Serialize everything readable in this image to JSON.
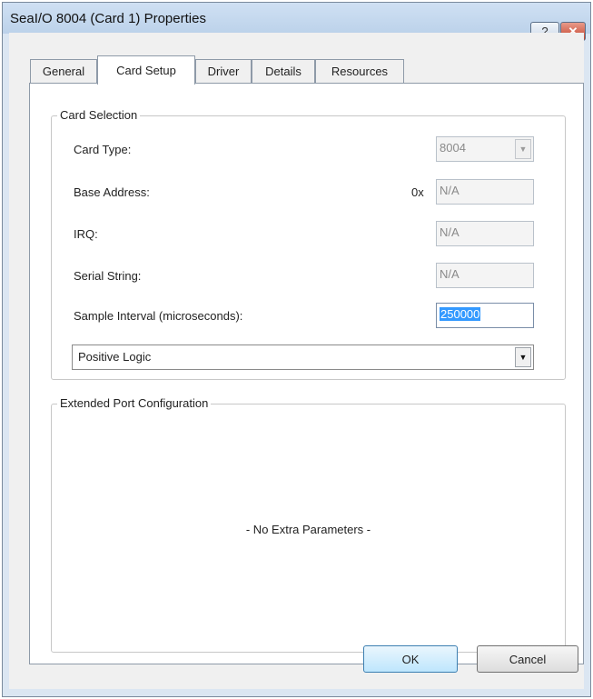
{
  "window": {
    "title": "SeaI/O 8004 (Card 1) Properties"
  },
  "titlebar": {
    "help_label": "?",
    "close_label": "✕"
  },
  "tabs": [
    {
      "label": "General"
    },
    {
      "label": "Card Setup"
    },
    {
      "label": "Driver"
    },
    {
      "label": "Details"
    },
    {
      "label": "Resources"
    }
  ],
  "card_selection": {
    "title": "Card Selection",
    "card_type": {
      "label": "Card Type:",
      "value": "8004"
    },
    "base_address": {
      "label": "Base Address:",
      "prefix": "0x",
      "value": "N/A"
    },
    "irq": {
      "label": "IRQ:",
      "value": "N/A"
    },
    "serial_string": {
      "label": "Serial String:",
      "value": "N/A"
    },
    "sample_interval": {
      "label": "Sample Interval (microseconds):",
      "value": "250000"
    },
    "logic": {
      "value": "Positive Logic"
    }
  },
  "extended_port": {
    "title": "Extended Port Configuration",
    "message": "- No Extra Parameters -"
  },
  "buttons": {
    "ok": "OK",
    "cancel": "Cancel"
  }
}
